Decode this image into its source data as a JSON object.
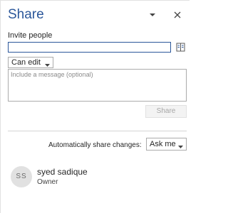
{
  "header": {
    "title": "Share",
    "dropdown_icon": "chevron-down-icon",
    "close_icon": "close-icon"
  },
  "invite": {
    "label": "Invite people",
    "value": "",
    "addressbook_icon": "address-book-icon",
    "permission": {
      "selected": "Can edit",
      "options": [
        "Can edit"
      ]
    },
    "message_placeholder": "Include a message (optional)",
    "share_label": "Share"
  },
  "auto_share": {
    "label": "Automatically share changes:",
    "selected": "Ask me"
  },
  "users": [
    {
      "initials": "SS",
      "name": "syed sadique",
      "role": "Owner"
    }
  ],
  "colors": {
    "accent": "#2b579a",
    "avatar_bg": "#e1e1e1",
    "disabled_text": "#a6a6a6"
  }
}
